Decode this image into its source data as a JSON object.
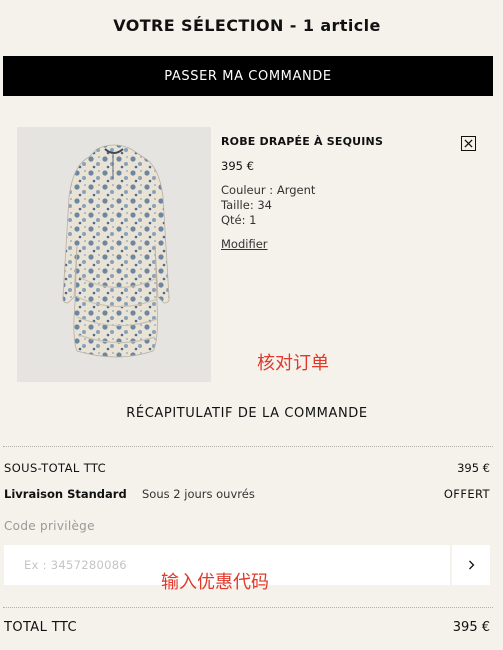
{
  "header": {
    "title": "VOTRE SÉLECTION - 1 article",
    "checkout_label": "PASSER MA COMMANDE"
  },
  "product": {
    "name": "ROBE DRAPÉE À SEQUINS",
    "price": "395 €",
    "color": "Couleur : Argent",
    "size": "Taille: 34",
    "qty": "Qté: 1",
    "modify_label": "Modifier",
    "image_icon": "dress-photo"
  },
  "annotations": {
    "review_order": "核对订单",
    "enter_promo": "输入优惠代码"
  },
  "summary": {
    "title": "RÉCAPITULATIF DE LA COMMANDE",
    "subtotal_label": "SOUS-TOTAL TTC",
    "subtotal_value": "395 €",
    "shipping_label": "Livraison Standard",
    "shipping_delay": "Sous 2 jours ouvrés",
    "shipping_value": "OFFERT",
    "promo_label": "Code privilège",
    "promo_placeholder": "Ex : 3457280086",
    "total_label": "TOTAL TTC",
    "total_value": "395 €"
  },
  "colors": {
    "background": "#f5f2ec",
    "button": "#000000",
    "annotation": "#e0392b"
  }
}
